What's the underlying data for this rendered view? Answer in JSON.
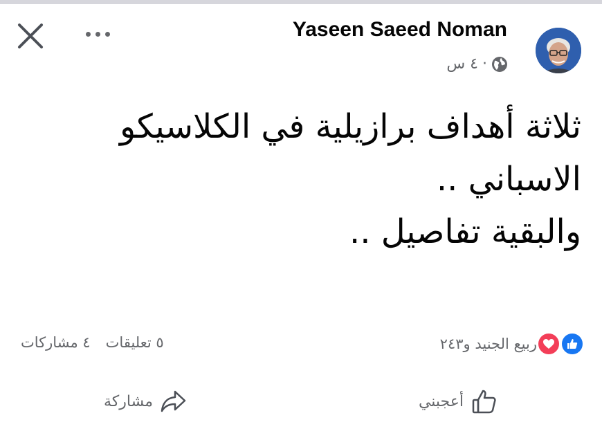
{
  "header": {
    "author_name": "Yaseen Saeed Noman",
    "time": "٤ س",
    "separator": "·",
    "close_icon": "close-icon",
    "more_icon": "more-options-icon",
    "audience_icon": "globe-icon"
  },
  "post": {
    "lines": [
      "ثلاثة أهداف برازيلية في الكلاسيكو",
      "الاسباني ..",
      "والبقية تفاصيل .."
    ]
  },
  "engagement": {
    "reactions_text": "ربيع الجنيد و٢٤٣",
    "comments": "٥ تعليقات",
    "shares": "٤ مشاركات"
  },
  "actions": {
    "like_label": "أعجبني",
    "share_label": "مشاركة"
  },
  "colors": {
    "like_blue": "#1877f2",
    "love_red": "#f33e58",
    "secondary_text": "#65676b"
  }
}
